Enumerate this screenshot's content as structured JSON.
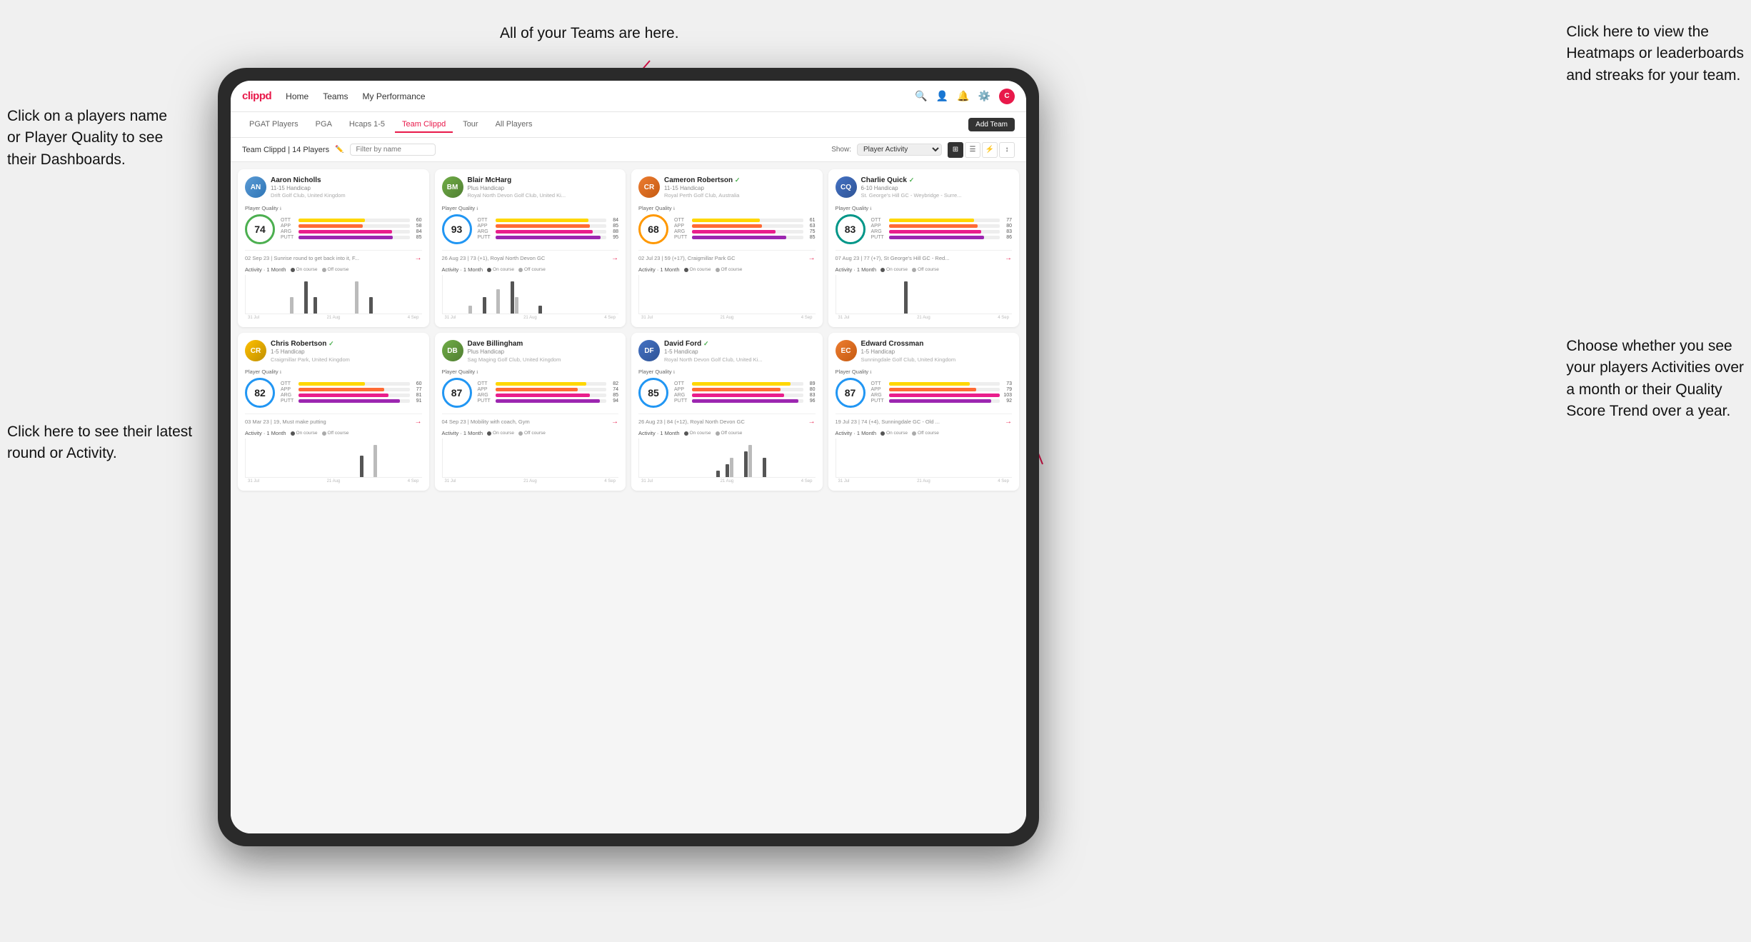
{
  "page": {
    "background": "#f0f0f0",
    "title": "Clippd Teams"
  },
  "annotations": {
    "top_center": "All of your Teams are here.",
    "top_right": "Click here to view the\nHeatmaps or leaderboards\nand streaks for your team.",
    "left_top": "Click on a players name\nor Player Quality to see\ntheir Dashboards.",
    "left_bottom": "Click here to see their latest\nround or Activity.",
    "right_bottom": "Choose whether you see\nyour players Activities over\na month or their Quality\nScore Trend over a year."
  },
  "navbar": {
    "logo": "clippd",
    "links": [
      "Home",
      "Teams",
      "My Performance"
    ],
    "active_link": "Teams"
  },
  "subtabs": {
    "tabs": [
      "PGAT Players",
      "PGA",
      "Hcaps 1-5",
      "Team Clippd",
      "Tour",
      "All Players"
    ],
    "active": "Team Clippd",
    "add_button": "Add Team"
  },
  "toolbar": {
    "team_label": "Team Clippd | 14 Players",
    "filter_placeholder": "Filter by name",
    "show_label": "Show:",
    "show_value": "Player Activity",
    "view_options": [
      "grid",
      "list",
      "filter",
      "sort"
    ]
  },
  "players": [
    {
      "id": "aaron",
      "name": "Aaron Nicholls",
      "handicap": "11-15 Handicap",
      "club": "Drift Golf Club, United Kingdom",
      "quality": 74,
      "quality_color": "green",
      "stats": {
        "OTT": 60,
        "APP": 58,
        "ARG": 84,
        "PUTT": 85
      },
      "latest_round": "02 Sep 23 | Sunrise round to get back into it, F...",
      "chart_data": [
        0,
        0,
        0,
        0,
        0,
        0,
        0,
        0,
        0,
        1,
        0,
        0,
        2,
        0,
        1,
        0,
        0,
        0,
        0,
        0,
        0,
        0,
        0,
        2,
        0,
        0,
        1,
        0
      ],
      "x_labels": [
        "31 Jul",
        "21 Aug",
        "4 Sep"
      ]
    },
    {
      "id": "blair",
      "name": "Blair McHarg",
      "handicap": "Plus Handicap",
      "club": "Royal North Devon Golf Club, United Ki...",
      "quality": 93,
      "quality_color": "blue",
      "stats": {
        "OTT": 84,
        "APP": 85,
        "ARG": 88,
        "PUTT": 95
      },
      "latest_round": "26 Aug 23 | 73 (+1), Royal North Devon GC",
      "chart_data": [
        0,
        0,
        0,
        0,
        0,
        1,
        0,
        0,
        2,
        0,
        0,
        3,
        0,
        0,
        4,
        2,
        0,
        0,
        0,
        0,
        1,
        0,
        0,
        0,
        0,
        0,
        0,
        0
      ],
      "x_labels": [
        "31 Jul",
        "21 Aug",
        "4 Sep"
      ]
    },
    {
      "id": "cameron",
      "name": "Cameron Robertson",
      "handicap": "11-15 Handicap",
      "club": "Royal Perth Golf Club, Australia",
      "quality": 68,
      "quality_color": "orange",
      "stats": {
        "OTT": 61,
        "APP": 63,
        "ARG": 75,
        "PUTT": 85
      },
      "latest_round": "02 Jul 23 | 59 (+17), Craigmillar Park GC",
      "chart_data": [
        0,
        0,
        0,
        0,
        0,
        0,
        0,
        0,
        0,
        0,
        0,
        0,
        0,
        0,
        0,
        0,
        0,
        0,
        0,
        0,
        0,
        0,
        0,
        0,
        0,
        0,
        0,
        0
      ],
      "x_labels": [
        "31 Jul",
        "21 Aug",
        "4 Sep"
      ]
    },
    {
      "id": "charlie",
      "name": "Charlie Quick",
      "handicap": "6-10 Handicap",
      "club": "St. George's Hill GC - Weybridge - Surre...",
      "quality": 83,
      "quality_color": "teal",
      "stats": {
        "OTT": 77,
        "APP": 80,
        "ARG": 83,
        "PUTT": 86
      },
      "latest_round": "07 Aug 23 | 77 (+7), St George's Hill GC - Red...",
      "chart_data": [
        0,
        0,
        0,
        0,
        0,
        0,
        0,
        0,
        0,
        0,
        0,
        0,
        0,
        0,
        2,
        0,
        0,
        0,
        0,
        0,
        0,
        0,
        0,
        0,
        0,
        0,
        0,
        0
      ],
      "x_labels": [
        "31 Jul",
        "21 Aug",
        "4 Sep"
      ]
    },
    {
      "id": "chris",
      "name": "Chris Robertson",
      "handicap": "1-5 Handicap",
      "club": "Craigmillar Park, United Kingdom",
      "quality": 82,
      "quality_color": "blue",
      "stats": {
        "OTT": 60,
        "APP": 77,
        "ARG": 81,
        "PUTT": 91
      },
      "latest_round": "03 Mar 23 | 19, Must make putting",
      "chart_data": [
        0,
        0,
        0,
        0,
        0,
        0,
        0,
        0,
        0,
        0,
        0,
        0,
        0,
        0,
        0,
        0,
        0,
        0,
        0,
        0,
        0,
        0,
        0,
        0,
        2,
        0,
        0,
        3
      ],
      "x_labels": [
        "31 Jul",
        "21 Aug",
        "4 Sep"
      ]
    },
    {
      "id": "dave",
      "name": "Dave Billingham",
      "handicap": "Plus Handicap",
      "club": "Sag Maging Golf Club, United Kingdom",
      "quality": 87,
      "quality_color": "blue",
      "stats": {
        "OTT": 82,
        "APP": 74,
        "ARG": 85,
        "PUTT": 94
      },
      "latest_round": "04 Sep 23 | Mobility with coach, Gym",
      "chart_data": [
        0,
        0,
        0,
        0,
        0,
        0,
        0,
        0,
        0,
        0,
        0,
        0,
        0,
        0,
        0,
        0,
        0,
        0,
        0,
        0,
        0,
        0,
        0,
        0,
        0,
        0,
        0,
        0
      ],
      "x_labels": [
        "31 Jul",
        "21 Aug",
        "4 Sep"
      ]
    },
    {
      "id": "david",
      "name": "David Ford",
      "handicap": "1-5 Handicap",
      "club": "Royal North Devon Golf Club, United Ki...",
      "quality": 85,
      "quality_color": "blue",
      "stats": {
        "OTT": 89,
        "APP": 80,
        "ARG": 83,
        "PUTT": 96
      },
      "latest_round": "26 Aug 23 | 84 (+12), Royal North Devon GC",
      "chart_data": [
        0,
        0,
        0,
        0,
        0,
        0,
        0,
        0,
        0,
        0,
        0,
        0,
        0,
        0,
        0,
        0,
        1,
        0,
        2,
        3,
        0,
        0,
        4,
        5,
        0,
        0,
        3,
        0
      ],
      "x_labels": [
        "31 Jul",
        "21 Aug",
        "4 Sep"
      ]
    },
    {
      "id": "edward",
      "name": "Edward Crossman",
      "handicap": "1-5 Handicap",
      "club": "Sunningdale Golf Club, United Kingdom",
      "quality": 87,
      "quality_color": "blue",
      "stats": {
        "OTT": 73,
        "APP": 79,
        "ARG": 103,
        "PUTT": 92
      },
      "latest_round": "19 Jul 23 | 74 (+4), Sunningdale GC - Old ...",
      "chart_data": [
        0,
        0,
        0,
        0,
        0,
        0,
        0,
        0,
        0,
        0,
        0,
        0,
        0,
        0,
        0,
        0,
        0,
        0,
        0,
        0,
        0,
        0,
        0,
        0,
        0,
        0,
        0,
        0
      ],
      "x_labels": [
        "31 Jul",
        "21 Aug",
        "4 Sep"
      ]
    }
  ]
}
